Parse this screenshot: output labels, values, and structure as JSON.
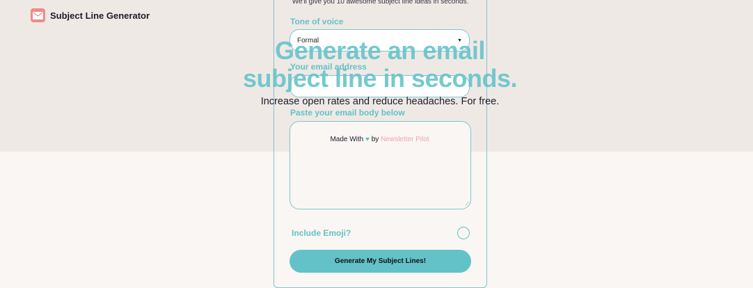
{
  "brand": {
    "name": "Subject Line Generator",
    "icon": "envelope-icon",
    "icon_color": "#f08a8a"
  },
  "form": {
    "intro": "We'll give you 10 awesome subject line ideas in seconds.",
    "tone_label": "Tone of voice",
    "tone_value": "Formal",
    "email_label": "Your email address",
    "email_value": "",
    "body_label": "Paste your email body below",
    "emoji_label": "Include Emoji?",
    "emoji_checked": false,
    "submit_label": "Generate My Subject Lines!"
  },
  "hero": {
    "title_line1": "Generate an email",
    "title_line2": "subject line in seconds.",
    "subtitle": "Increase open rates and reduce headaches. For free."
  },
  "footer": {
    "made_with": "Made With",
    "heart": "♥",
    "by": "by",
    "link": "Newsletter Pilot"
  },
  "colors": {
    "accent": "#63c2c8",
    "band": "#efe9e5",
    "background": "#faf6f3",
    "link_pink": "#f0a2b5",
    "text": "#1d1b2e"
  }
}
